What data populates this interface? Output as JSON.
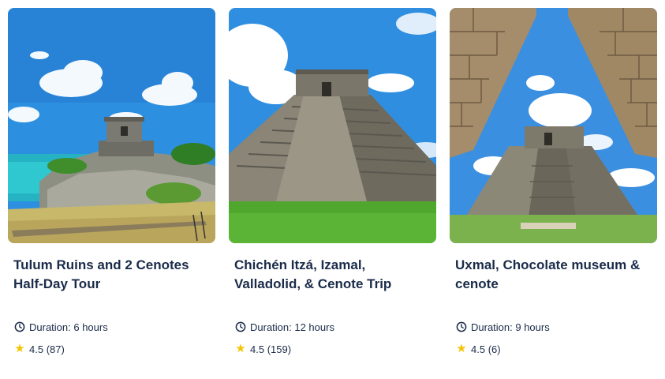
{
  "cards": [
    {
      "title": "Tulum Ruins and 2 Cenotes Half-Day Tour",
      "duration": "Duration: 6 hours",
      "rating": "4.5",
      "reviews": "(87)"
    },
    {
      "title": "Chichén Itzá, Izamal, Valladolid, & Cenote Trip",
      "duration": "Duration: 12 hours",
      "rating": "4.5",
      "reviews": "(159)"
    },
    {
      "title": "Uxmal, Chocolate museum & cenote",
      "duration": "Duration: 9 hours",
      "rating": "4.5",
      "reviews": "(6)"
    }
  ],
  "icons": {
    "duration": "clock-icon",
    "rating": "star-icon"
  },
  "colors": {
    "text": "#1a2b49",
    "star": "#f5c400",
    "sky": "#2f8ee0",
    "grass": "#4fa72e"
  }
}
